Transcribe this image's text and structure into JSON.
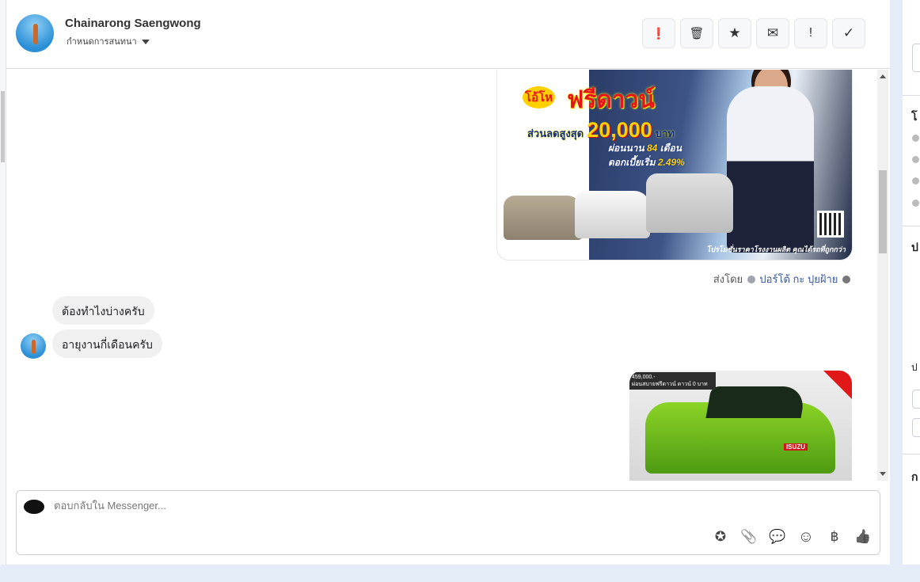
{
  "header": {
    "contact_name": "Chainarong Saengwong",
    "assign_label": "กำหนดการสนทนา",
    "actions": [
      {
        "icon": "alert-circle-icon",
        "glyph": "❗"
      },
      {
        "icon": "trash-icon",
        "glyph": "🗑"
      },
      {
        "icon": "star-icon",
        "glyph": "★"
      },
      {
        "icon": "envelope-icon",
        "glyph": "✉"
      },
      {
        "icon": "exclamation-icon",
        "glyph": "!"
      },
      {
        "icon": "check-icon",
        "glyph": "✓"
      }
    ]
  },
  "messages": {
    "ad_image": {
      "badge": "โอ้โห",
      "headline": "ฟรีดาวน์",
      "discount_prefix": "ส่วนลดสูงสุด",
      "discount_amount": "20,000",
      "discount_unit": "บาท",
      "installment_prefix": "ผ่อนนาน",
      "installment_months": "84",
      "installment_unit": "เดือน",
      "interest_prefix": "ดอกเบี้ยเริ่ม",
      "interest_rate": "2.49%",
      "footer": "โปรโมชั่นราคาโรงงานผลิต คุณได้รถที่ถูกกว่า"
    },
    "sent_by_label": "ส่งโดย",
    "sent_by_name": "ปอร์โต้ กะ ปุยฝ้าย",
    "incoming": [
      "ต้องทำไงบ่างครับ",
      "อายุงานกี่เดือนครับ"
    ],
    "truck_image": {
      "price": "459,000.-",
      "caption": "ผ่อนสบายฟรีดาวน์ ดาวน์ 0 บาท",
      "brand": "ISUZU"
    }
  },
  "composer": {
    "placeholder": "ตอบกลับใน Messenger...",
    "tools": [
      {
        "icon": "saved-reply-icon",
        "glyph": "✪"
      },
      {
        "icon": "paperclip-icon",
        "glyph": "📎"
      },
      {
        "icon": "chat-bubble-icon",
        "glyph": "💬"
      },
      {
        "icon": "emoji-icon",
        "glyph": "☺"
      },
      {
        "icon": "baht-icon",
        "glyph": "฿"
      },
      {
        "icon": "thumbs-up-icon",
        "glyph": "👍"
      }
    ]
  },
  "right_panel": {
    "headings": [
      "โ",
      "ป",
      "ป",
      "ก"
    ]
  },
  "colors": {
    "link": "#385898",
    "bubble": "#f0f0f0",
    "background": "#e4ecf8"
  }
}
